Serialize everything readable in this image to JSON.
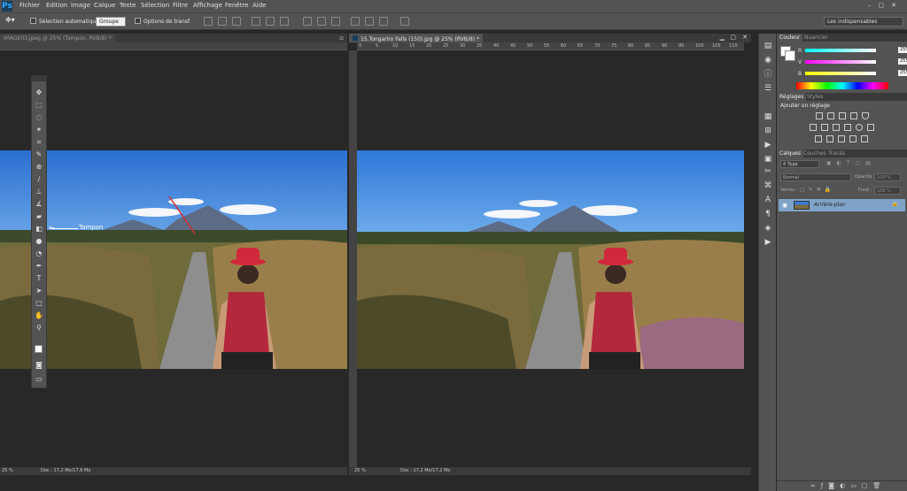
{
  "app": {
    "logo": "Ps"
  },
  "menubar": {
    "items": [
      "Fichier",
      "Edition",
      "Image",
      "Calque",
      "Texte",
      "Sélection",
      "Filtre",
      "Affichage",
      "Fenêtre",
      "Aide"
    ],
    "window_controls": "–▢✕"
  },
  "options": {
    "auto_select_label": "Sélection automatique :",
    "auto_select_value": "Groupe",
    "transform_label": "Options de transf.",
    "workspace": "Les indispensables"
  },
  "docs": {
    "left": {
      "tab": "IMAGE03.jpeg @ 25% (Tampon, RVB/8) *",
      "zoom": "25 %",
      "doc_info": "Doc : 17,2 Mo/17,6 Mo",
      "annotation": "Tampon"
    },
    "right": {
      "tab": "15.Tongariro Falls (150).jpg @ 25% (RVB/8) *",
      "zoom": "25 %",
      "doc_info": "Doc : 17,2 Mo/17,2 Mo",
      "ruler_ticks": [
        "0",
        "5",
        "10",
        "15",
        "20",
        "25",
        "30",
        "35",
        "40",
        "45",
        "50",
        "55",
        "60",
        "65",
        "70",
        "75",
        "80",
        "85",
        "90",
        "95",
        "100",
        "105",
        "110"
      ]
    }
  },
  "tools": [
    "move-icon",
    "marquee-icon",
    "lasso-icon",
    "magic-wand-icon",
    "crop-icon",
    "eyedropper-icon",
    "healing-icon",
    "brush-icon",
    "clone-stamp-icon",
    "history-brush-icon",
    "eraser-icon",
    "gradient-icon",
    "blur-icon",
    "dodge-icon",
    "pen-icon",
    "type-icon",
    "path-select-icon",
    "shape-icon",
    "hand-icon",
    "zoom-icon"
  ],
  "panels": {
    "color_tabs": [
      "Couleur",
      "Nuancier"
    ],
    "rgb": {
      "r_label": "R",
      "g_label": "V",
      "b_label": "B",
      "r": "255",
      "g": "255",
      "b": "255"
    },
    "adj_tabs": [
      "Réglages",
      "Styles"
    ],
    "adj_title": "Ajouter un réglage",
    "layer_tabs": [
      "Calques",
      "Couches",
      "Tracés"
    ],
    "kind_label": "Type",
    "blend_mode": "Normal",
    "opacity_label": "Opacité :",
    "opacity": "100 %",
    "lock_label": "Verrou :",
    "fill_label": "Fond :",
    "fill": "100 %",
    "layer_name": "Arrière-plan"
  }
}
